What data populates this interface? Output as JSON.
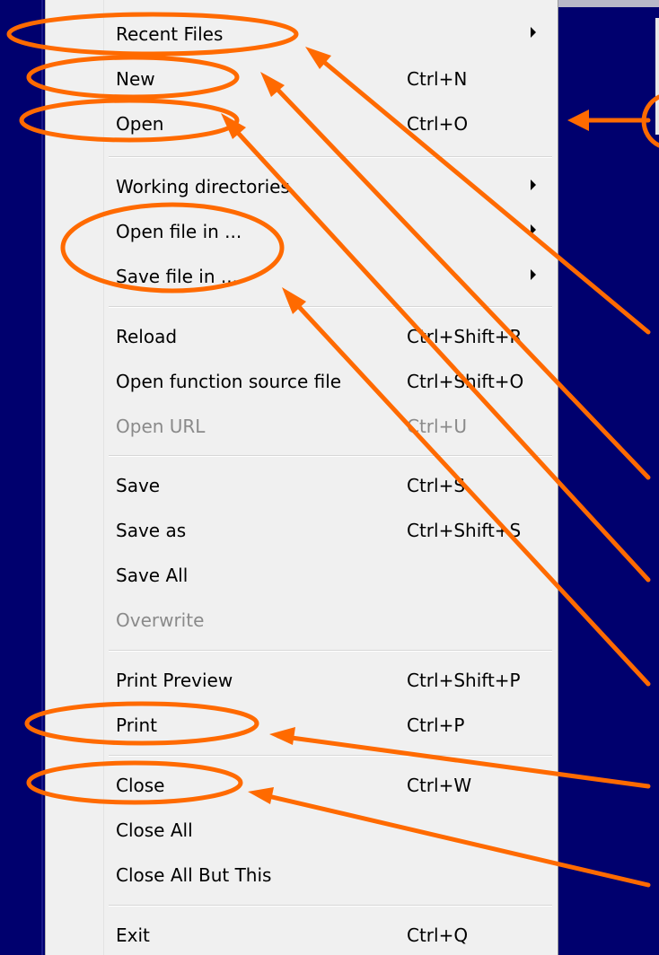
{
  "menu": {
    "items": [
      {
        "label": "Recent Files",
        "shortcut": "",
        "submenu": true,
        "disabled": false
      },
      {
        "label": "New",
        "shortcut": "Ctrl+N",
        "submenu": false,
        "disabled": false
      },
      {
        "label": "Open",
        "shortcut": "Ctrl+O",
        "submenu": false,
        "disabled": false
      },
      {
        "label": "Working directories",
        "shortcut": "",
        "submenu": true,
        "disabled": false
      },
      {
        "label": "Open file in ...",
        "shortcut": "",
        "submenu": true,
        "disabled": false
      },
      {
        "label": "Save file in ...",
        "shortcut": "",
        "submenu": true,
        "disabled": false
      },
      {
        "label": "Reload",
        "shortcut": "Ctrl+Shift+R",
        "submenu": false,
        "disabled": false
      },
      {
        "label": "Open function source file",
        "shortcut": "Ctrl+Shift+O",
        "submenu": false,
        "disabled": false
      },
      {
        "label": "Open URL",
        "shortcut": "Ctrl+U",
        "submenu": false,
        "disabled": true
      },
      {
        "label": "Save",
        "shortcut": "Ctrl+S",
        "submenu": false,
        "disabled": false
      },
      {
        "label": "Save as",
        "shortcut": "Ctrl+Shift+S",
        "submenu": false,
        "disabled": false
      },
      {
        "label": "Save All",
        "shortcut": "",
        "submenu": false,
        "disabled": false
      },
      {
        "label": "Overwrite",
        "shortcut": "",
        "submenu": false,
        "disabled": true
      },
      {
        "label": "Print Preview",
        "shortcut": "Ctrl+Shift+P",
        "submenu": false,
        "disabled": false
      },
      {
        "label": "Print",
        "shortcut": "Ctrl+P",
        "submenu": false,
        "disabled": false
      },
      {
        "label": "Close",
        "shortcut": "Ctrl+W",
        "submenu": false,
        "disabled": false
      },
      {
        "label": "Close All",
        "shortcut": "",
        "submenu": false,
        "disabled": false
      },
      {
        "label": "Close All But This",
        "shortcut": "",
        "submenu": false,
        "disabled": false
      },
      {
        "label": "Exit",
        "shortcut": "Ctrl+Q",
        "submenu": false,
        "disabled": false
      }
    ]
  },
  "colors": {
    "background": "#00006e",
    "menu_bg": "#f0f0f0",
    "annotation": "#ff6a00",
    "disabled_text": "#8a8a8a"
  },
  "icons": {
    "submenu_arrow": "chevron-right-icon"
  }
}
